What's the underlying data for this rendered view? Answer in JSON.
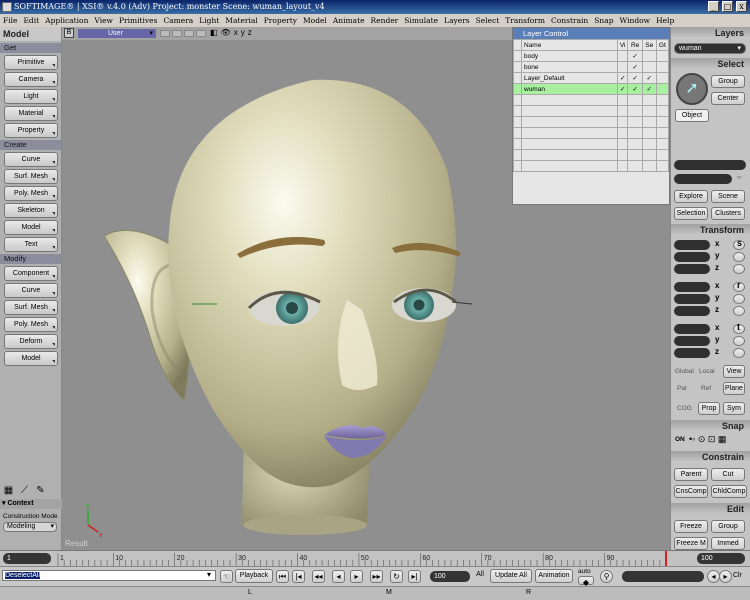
{
  "window": {
    "title": "SOFTIMAGE® | XSI® v.4.0 (Adv) Project: monster    Scene: wuman_layout_v4",
    "min_label": "_",
    "max_label": "□",
    "close_label": "x"
  },
  "menu": [
    "File",
    "Edit",
    "Application",
    "View",
    "Primitives",
    "Camera",
    "Light",
    "Material",
    "Property",
    "Model",
    "Animate",
    "Render",
    "Simulate",
    "Layers",
    "Select",
    "Transform",
    "Constrain",
    "Snap",
    "Window",
    "Help"
  ],
  "left_panel": {
    "title": "Model",
    "get_label": "Get",
    "get_buttons": [
      "Primitive",
      "Camera",
      "Light",
      "Material",
      "Property"
    ],
    "create_label": "Create",
    "create_buttons": [
      "Curve",
      "Surf. Mesh",
      "Poly. Mesh",
      "Skeleton",
      "Model",
      "Text"
    ],
    "modify_label": "Modify",
    "modify_buttons": [
      "Component",
      "Curve",
      "Surf. Mesh",
      "Poly. Mesh",
      "Deform",
      "Model"
    ],
    "context_label": "Context",
    "construction_mode_label": "Construction Mode",
    "construction_mode_value": "Modeling"
  },
  "viewport": {
    "letter": "B",
    "camera": "User",
    "result_label": "Result",
    "axis_x": "x",
    "axis_y": "y"
  },
  "layer_control": {
    "title": "Layer Control",
    "columns": [
      "Name",
      "Vi",
      "Re",
      "Se",
      "Gt"
    ],
    "rows": [
      {
        "name": "body",
        "vi": "",
        "re": "✓",
        "se": "",
        "gt": ""
      },
      {
        "name": "bone",
        "vi": "",
        "re": "✓",
        "se": "",
        "gt": ""
      },
      {
        "name": "Layer_Default",
        "vi": "✓",
        "re": "✓",
        "se": "✓",
        "gt": ""
      },
      {
        "name": "wuman",
        "vi": "✓",
        "re": "✓",
        "se": "✓",
        "gt": ""
      }
    ]
  },
  "right_panel": {
    "layers_label": "Layers",
    "layer_value": "wuman",
    "select_label": "Select",
    "group_button": "Group",
    "center_button": "Center",
    "object_button": "Object",
    "explore_button": "Explore",
    "scene_button": "Scene",
    "selection_button": "Selection",
    "clusters_button": "Clusters",
    "transform_label": "Transform",
    "axis_labels": [
      "x",
      "y",
      "z"
    ],
    "scale_key": "s",
    "rotate_key": "r",
    "translate_key": "t",
    "global_label": "Global",
    "local_label": "Local",
    "view_button": "View",
    "par_label": "Par",
    "ref_label": "Ref",
    "plane_button": "Plane",
    "cog_label": "COG",
    "prop_button": "Prop",
    "sym_button": "Sym",
    "snap_label": "Snap",
    "snap_on": "ON",
    "constrain_label": "Constrain",
    "parent_button": "Parent",
    "cut_button": "Cut",
    "cnscomp_button": "CnsComp",
    "childcomp_button": "ChldComp",
    "edit_label": "Edit",
    "freeze_button": "Freeze",
    "egroup_button": "Group",
    "freezem_button": "Freeze M",
    "immed_button": "Immed"
  },
  "timeline": {
    "start": "1",
    "end": "100",
    "ticks": [
      "1",
      "10",
      "20",
      "30",
      "40",
      "50",
      "60",
      "70",
      "80",
      "90"
    ]
  },
  "bottom": {
    "command": "DeselectAll",
    "playback_label": "Playback",
    "frame_value": "100",
    "all_label": "All",
    "update_all_label": "Update All",
    "animation_label": "Animation",
    "auto_label": "auto",
    "clr_label": "Clr"
  },
  "status": {
    "left_mouse": "L",
    "middle_mouse": "M",
    "right_mouse": "R"
  },
  "colors": {
    "viewport_bg": "#8f8f8f",
    "skin": "#d6d2ae",
    "iris": "#5a9a96",
    "lips": "#9890c4",
    "layer_selected": "#a8f0a0"
  }
}
